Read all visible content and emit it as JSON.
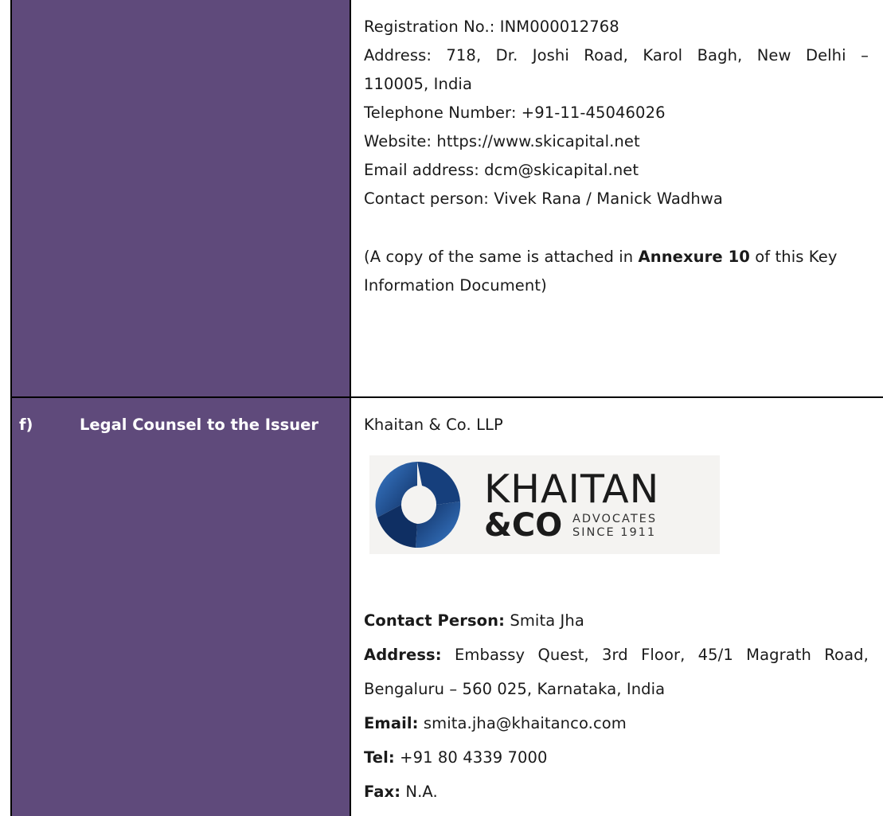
{
  "row_e": {
    "registration": "Registration No.: INM000012768",
    "address_line1_words": [
      "Address:",
      "718,",
      "Dr.",
      "Joshi",
      "Road,",
      "Karol",
      "Bagh,",
      "New",
      "Delhi",
      "–"
    ],
    "address_line2": "110005, India",
    "telephone": "Telephone Number: +91-11-45046026",
    "website": "Website: https://www.skicapital.net",
    "email": "Email address: dcm@skicapital.net",
    "contact": "Contact person: Vivek Rana / Manick Wadhwa",
    "annex_pre": "(A copy of the same is attached in ",
    "annex_bold": "Annexure 10",
    "annex_post": " of this Key",
    "annex_line2": "Information Document)"
  },
  "row_f": {
    "item_letter": "f)",
    "item_title": "Legal Counsel to the Issuer",
    "firm_name": "Khaitan & Co. LLP",
    "logo": {
      "icon": "khaitan-logo-mark-icon",
      "word1": "KHAITAN",
      "word2": "&CO",
      "word3": "ADVOCATES",
      "word4": "SINCE 1911"
    },
    "contact_label": "Contact Person:",
    "contact_value": " Smita Jha",
    "address_label": "Address:",
    "address_line1_words": [
      "Embassy",
      "Quest,",
      "3rd",
      "Floor,",
      "45/1",
      "Magrath",
      "Road,"
    ],
    "address_line2": "Bengaluru – 560 025, Karnataka, India",
    "email_label": "Email:",
    "email_value": " smita.jha@khaitanco.com",
    "tel_label": "Tel:",
    "tel_value": " +91 80 4339 7000",
    "fax_label": "Fax:",
    "fax_value": " N.A."
  },
  "colors": {
    "left_column_fill": "#5f4a7b",
    "logo_blue_dark": "#0f2f63",
    "logo_blue_light": "#2f6fc0"
  }
}
